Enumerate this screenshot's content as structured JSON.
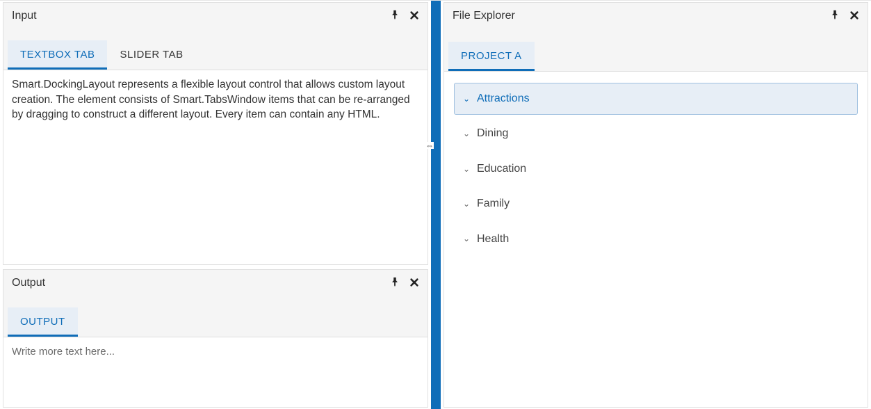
{
  "colors": {
    "accent": "#0f6db8",
    "panelBg": "#f5f5f5",
    "tabActiveBg": "#e7eef6"
  },
  "input": {
    "title": "Input",
    "tabs": [
      {
        "label": "TEXTBOX TAB",
        "active": true
      },
      {
        "label": "SLIDER TAB",
        "active": false
      }
    ],
    "body": "Smart.DockingLayout represents a flexible layout control that allows custom layout creation. The element consists of Smart.TabsWindow items that can be re-arranged by dragging to construct a different layout. Every item can contain any HTML."
  },
  "output": {
    "title": "Output",
    "tabs": [
      {
        "label": "OUTPUT",
        "active": true
      }
    ],
    "body": "Write more text here..."
  },
  "explorer": {
    "title": "File Explorer",
    "tabs": [
      {
        "label": "PROJECT A",
        "active": true
      }
    ],
    "tree": [
      {
        "label": "Attractions",
        "selected": true,
        "expanded": true
      },
      {
        "label": "Dining",
        "selected": false,
        "expanded": false
      },
      {
        "label": "Education",
        "selected": false,
        "expanded": false
      },
      {
        "label": "Family",
        "selected": false,
        "expanded": false
      },
      {
        "label": "Health",
        "selected": false,
        "expanded": false
      }
    ]
  },
  "icons": {
    "pin": "pin-icon",
    "close": "close-icon",
    "chevronDown": "chevron-down-icon",
    "resize": "resize-horizontal-icon"
  }
}
